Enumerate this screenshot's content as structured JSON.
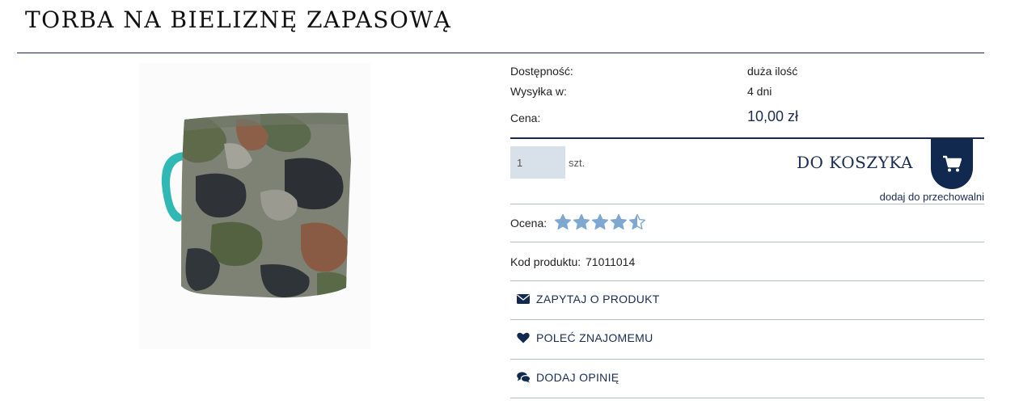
{
  "product": {
    "title": "TORBA NA BIELIZNĘ ZAPASOWĄ",
    "image_alt": "camouflage laundry bag"
  },
  "details": {
    "availability_label": "Dostępność:",
    "availability_value": "duża ilość",
    "shipping_label": "Wysyłka w:",
    "shipping_value": "4 dni",
    "price_label": "Cena:",
    "price_value": "10,00 zł"
  },
  "cart": {
    "quantity_value": "1",
    "quantity_unit": "szt.",
    "add_to_cart_label": "DO KOSZYKA",
    "add_to_storage_label": "dodaj do przechowalni"
  },
  "rating": {
    "label": "Ocena:",
    "value": 4.5,
    "max": 5,
    "star_color": "#7fa8d1"
  },
  "product_code": {
    "label": "Kod produktu:",
    "value": "71011014"
  },
  "actions": {
    "ask_label": "ZAPYTAJ O PRODUKT",
    "recommend_label": "POLEĆ ZNAJOMEMU",
    "review_label": "DODAJ OPINIĘ"
  },
  "colors": {
    "brand_navy": "#12294f",
    "input_bg": "#d8e0ea"
  }
}
